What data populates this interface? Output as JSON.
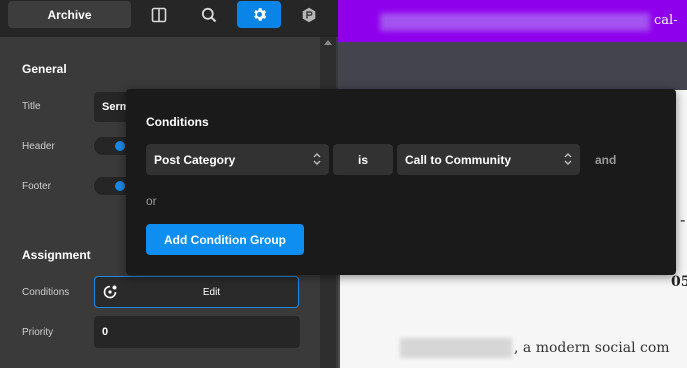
{
  "toolbar": {
    "archive_tab": "Archive",
    "icons": [
      "layout-icon",
      "search-icon",
      "settings-icon",
      "plugin-icon"
    ],
    "active_icon": "settings-icon",
    "accent": "#0b84e8"
  },
  "general": {
    "section_title": "General",
    "title_label": "Title",
    "title_value": "Serm",
    "header_label": "Header",
    "header_enabled": true,
    "footer_label": "Footer",
    "footer_enabled": true
  },
  "assignment": {
    "section_title": "Assignment",
    "conditions_label": "Conditions",
    "conditions_button": "Edit",
    "priority_label": "Priority",
    "priority_value": "0"
  },
  "conditions_popover": {
    "title": "Conditions",
    "field_select": "Post Category",
    "operator": "is",
    "value_select": "Call to Community",
    "and_label": "and",
    "or_label": "or",
    "add_group_button": "Add Condition Group"
  },
  "preview": {
    "header_text_fragment": "cal-",
    "dash_char": "-",
    "number_fragment": "05",
    "body_text": ", a modern social com",
    "brand_color": "#8e00ec"
  }
}
